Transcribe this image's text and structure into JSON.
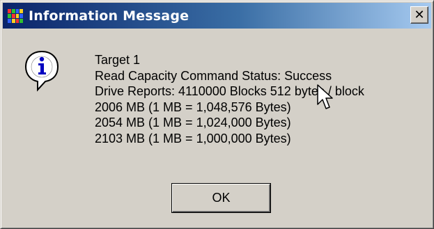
{
  "window": {
    "title": "Information Message",
    "close_symbol": "✕",
    "app_icon": "app-grid-icon",
    "colors": {
      "titlebar_start": "#0a246a",
      "titlebar_end": "#a6caf0",
      "face": "#d4d0c8"
    }
  },
  "message": {
    "icon": "information-icon",
    "lines": [
      "Target 1",
      "Read Capacity Command Status: Success",
      "Drive Reports: 4110000 Blocks 512 bytes / block",
      "2006 MB (1 MB = 1,048,576 Bytes)",
      "2054 MB (1 MB = 1,024,000 Bytes)",
      "2103 MB (1 MB = 1,000,000 Bytes)"
    ]
  },
  "buttons": {
    "ok_label": "OK"
  }
}
